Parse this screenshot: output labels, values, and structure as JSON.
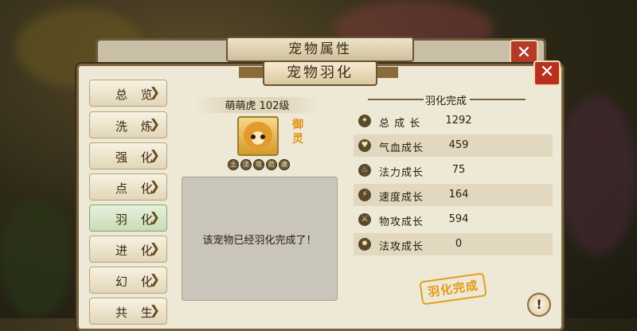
{
  "back_window": {
    "title": "宠物属性",
    "close_symbol": "✕"
  },
  "main_window": {
    "title": "宠物羽化",
    "close_symbol": "✕"
  },
  "sidebar": {
    "tabs": [
      {
        "label": "总 览",
        "active": false
      },
      {
        "label": "洗 炼",
        "active": false
      },
      {
        "label": "强 化",
        "active": false
      },
      {
        "label": "点 化",
        "active": false
      },
      {
        "label": "羽 化",
        "active": true
      },
      {
        "label": "进 化",
        "active": false
      },
      {
        "label": "幻 化",
        "active": false
      },
      {
        "label": "共 生",
        "active": false
      }
    ],
    "chevron": "❯"
  },
  "pet": {
    "name_level": "萌萌虎 102级",
    "type_badge": "御灵",
    "skill_icons": [
      "土",
      "法",
      "攻",
      "防",
      "速"
    ]
  },
  "message": "该宠物已经羽化完成了！",
  "stats": {
    "header": "羽化完成",
    "rows": [
      {
        "icon": "growth-icon",
        "name": "总 成 长",
        "value": "1292"
      },
      {
        "icon": "heart-icon",
        "name": "气血成长",
        "value": "459"
      },
      {
        "icon": "flame-icon",
        "name": "法力成长",
        "value": "75"
      },
      {
        "icon": "lightning-icon",
        "name": "速度成长",
        "value": "164"
      },
      {
        "icon": "sword-icon",
        "name": "物攻成长",
        "value": "594"
      },
      {
        "icon": "fire-icon",
        "name": "法攻成长",
        "value": "0"
      }
    ]
  },
  "stamp_text": "羽化完成",
  "help_symbol": "!",
  "colors": {
    "accent_gold": "#e29a10",
    "close_red": "#b9301f",
    "active_tab": "#c9dcb6"
  }
}
